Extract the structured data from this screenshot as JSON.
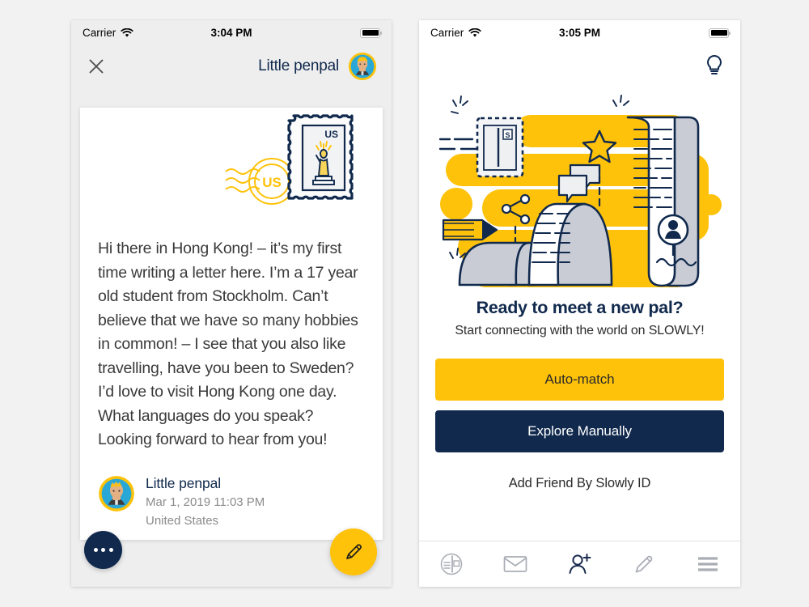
{
  "colors": {
    "yellow": "#FFC20A",
    "navy": "#10294d",
    "page_bg": "#f2f2f2",
    "panel_bg": "#eeeeee",
    "card_bg": "#ffffff",
    "body_text": "#3a3a3a",
    "muted_text": "#8b8b8b",
    "avatar_face": "#e3b083",
    "avatar_circle": "#29a8d8"
  },
  "left_phone": {
    "status_bar": {
      "carrier": "Carrier",
      "time": "3:04 PM",
      "wifi_icon": "wifi-icon",
      "battery_icon": "battery-full-icon"
    },
    "nav": {
      "close_icon": "close-icon",
      "title": "Little penpal",
      "avatar_icon": "penpal-avatar"
    },
    "letter": {
      "stamp": {
        "stamp_icon": "postage-stamp-icon",
        "stamp_country": "US",
        "stamp_art": "statue-of-liberty-icon",
        "postmark_text": "US",
        "postmark_icon": "postmark-icon"
      },
      "body": "Hi there in Hong Kong! – it’s my first time writing a letter here. I’m a 17 year old student from Stockholm. Can’t believe that we have so many hobbies in common! – I see that you also like travelling, have you been to Sweden? I’d love to visit Hong Kong one day. What languages do you speak? Looking forward to hear from you!",
      "signature": {
        "name": "Little penpal",
        "date": "Mar 1, 2019 11:03 PM",
        "location": "United States"
      }
    },
    "fabs": {
      "more_icon": "more-options-icon",
      "compose_icon": "pencil-compose-icon"
    }
  },
  "right_phone": {
    "status_bar": {
      "carrier": "Carrier",
      "time": "3:05 PM",
      "wifi_icon": "wifi-icon",
      "battery_icon": "battery-full-icon"
    },
    "nav": {
      "hint_icon": "lightbulb-icon"
    },
    "hero": {
      "illustration_icon": "penpal-letters-illustration",
      "elements": [
        "postage-stamp-icon",
        "pencil-icon",
        "share-icon",
        "chat-bubbles-icon",
        "star-icon",
        "letter-scroll-icon",
        "person-avatar-icon",
        "sparkle-icon"
      ]
    },
    "cta": {
      "title": "Ready to meet a new pal?",
      "subtitle": "Start connecting with the world on SLOWLY!",
      "auto_match_label": "Auto-match",
      "explore_label": "Explore Manually",
      "add_friend_label": "Add Friend By Slowly ID"
    },
    "tabbar": {
      "items": [
        {
          "name": "tab-stamps",
          "icon": "stamp-circle-icon",
          "active": false
        },
        {
          "name": "tab-mail",
          "icon": "envelope-icon",
          "active": false
        },
        {
          "name": "tab-add-friend",
          "icon": "person-plus-icon",
          "active": true
        },
        {
          "name": "tab-write",
          "icon": "pencil-icon",
          "active": false
        },
        {
          "name": "tab-menu",
          "icon": "hamburger-menu-icon",
          "active": false
        }
      ]
    }
  }
}
